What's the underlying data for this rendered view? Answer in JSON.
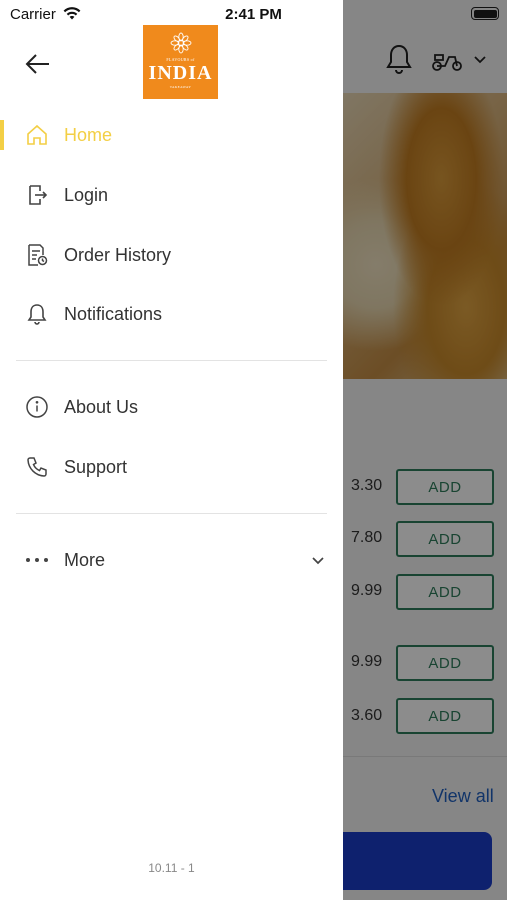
{
  "status_bar": {
    "carrier": "Carrier",
    "time": "2:41 PM"
  },
  "drawer": {
    "logo": {
      "small_text": "FLAVOURS of",
      "main_text": "INDIA",
      "sub_text": "TAKEAWAY"
    },
    "menu": {
      "home": "Home",
      "login": "Login",
      "order_history": "Order History",
      "notifications": "Notifications",
      "about_us": "About Us",
      "support": "Support",
      "more": "More"
    },
    "version": "10.11 - 1",
    "accent_color": "#f3cf45"
  },
  "background": {
    "items": [
      {
        "price": "3.30",
        "add_label": "ADD"
      },
      {
        "price": "7.80",
        "add_label": "ADD"
      },
      {
        "price": "9.99",
        "add_label": "ADD"
      },
      {
        "price": "9.99",
        "add_label": "ADD"
      },
      {
        "price": "3.60",
        "add_label": "ADD"
      }
    ],
    "view_all": "View all"
  }
}
